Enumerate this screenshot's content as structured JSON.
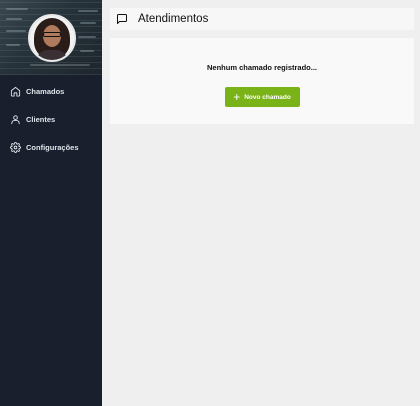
{
  "sidebar": {
    "items": [
      {
        "label": "Chamados",
        "icon": "home-icon"
      },
      {
        "label": "Clientes",
        "icon": "user-icon"
      },
      {
        "label": "Configurações",
        "icon": "gear-icon"
      }
    ]
  },
  "header": {
    "title": "Atendimentos",
    "icon": "chat-bubble-icon"
  },
  "main": {
    "empty_message": "Nenhum chamado registrado...",
    "new_button_label": "Novo chamado",
    "new_button_icon": "plus-icon"
  },
  "colors": {
    "sidebar_bg": "#1a1f2e",
    "accent_green": "#7ab317",
    "page_bg": "#efefef"
  }
}
